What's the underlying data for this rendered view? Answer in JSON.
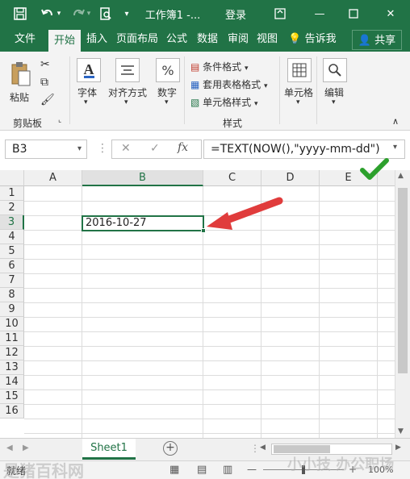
{
  "window": {
    "doc_title": "工作簿1 -...",
    "login_label": "登录",
    "minimize_glyph": "—",
    "restore_glyph": "❐",
    "close_glyph": "✕"
  },
  "tabs": {
    "file": "文件",
    "home": "开始",
    "insert": "插入",
    "page_layout": "页面布局",
    "formulas": "公式",
    "data": "数据",
    "review": "审阅",
    "view": "视图",
    "tell_me": "告诉我",
    "share": "共享"
  },
  "ribbon": {
    "paste": "粘贴",
    "clipboard_group": "剪贴板",
    "font": "字体",
    "alignment": "对齐方式",
    "number": "数字",
    "cond_format": "条件格式",
    "table_format": "套用表格格式",
    "cell_styles": "单元格样式",
    "styles_group": "样式",
    "cells": "单元格",
    "editing": "编辑"
  },
  "formula_bar": {
    "name_box": "B3",
    "formula": "=TEXT(NOW(),\"yyyy-mm-dd\")"
  },
  "grid": {
    "columns": [
      "A",
      "B",
      "C",
      "D",
      "E"
    ],
    "rows": [
      "1",
      "2",
      "3",
      "4",
      "5",
      "6",
      "7",
      "8",
      "9",
      "10",
      "11",
      "12",
      "13",
      "14",
      "15",
      "16"
    ],
    "selected_cell_value": "2016-10-27"
  },
  "sheet": {
    "tab_name": "Sheet1"
  },
  "status": {
    "ready": "就绪",
    "zoom": "100%"
  },
  "watermark": {
    "left_text": "是猪百科网",
    "right_text": "小小技 办公职场"
  },
  "colors": {
    "accent": "#217346",
    "checkmark": "#2ca02c",
    "arrow": "#e03c3c"
  }
}
